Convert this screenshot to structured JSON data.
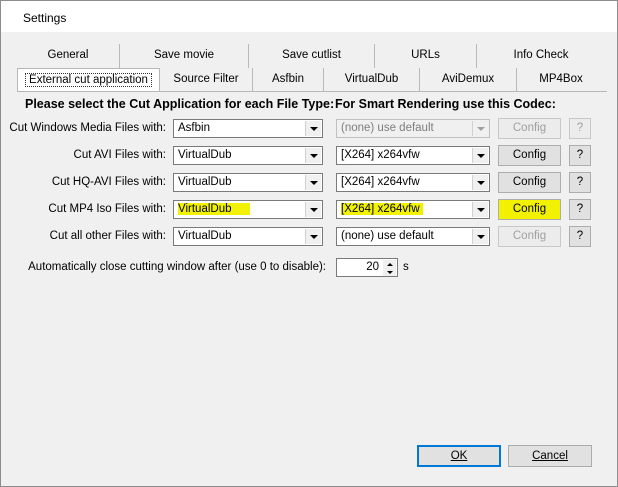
{
  "window": {
    "title": "Settings"
  },
  "tabs_row1": [
    "General",
    "Save movie",
    "Save cutlist",
    "URLs",
    "Info Check"
  ],
  "tabs_row2": [
    "External cut application",
    "Source Filter",
    "Asfbin",
    "VirtualDub",
    "AviDemux",
    "MP4Box"
  ],
  "active_tab": "External cut application",
  "headers": {
    "cut_app": "Please select the Cut Application for each File Type:",
    "codec": "For Smart Rendering use this Codec:"
  },
  "rows": [
    {
      "label": "Cut Windows Media Files with:",
      "app": "Asfbin",
      "codec": "(none) use default",
      "codec_enabled": false,
      "config": "Config",
      "help": "?",
      "highlighted": false
    },
    {
      "label": "Cut AVI Files with:",
      "app": "VirtualDub",
      "codec": "[X264] x264vfw",
      "codec_enabled": true,
      "config": "Config",
      "help": "?",
      "highlighted": false
    },
    {
      "label": "Cut HQ-AVI Files with:",
      "app": "VirtualDub",
      "codec": "[X264] x264vfw",
      "codec_enabled": true,
      "config": "Config",
      "help": "?",
      "highlighted": false
    },
    {
      "label": "Cut MP4 Iso Files with:",
      "app": "VirtualDub",
      "codec": "[X264] x264vfw",
      "codec_enabled": true,
      "config": "Config",
      "help": "?",
      "highlighted": true
    },
    {
      "label": "Cut all other Files with:",
      "app": "VirtualDub",
      "codec": "(none) use default",
      "codec_enabled": true,
      "config": "Config",
      "config_enabled": false,
      "help": "?",
      "highlighted": false
    }
  ],
  "autoclose": {
    "label": "Automatically close cutting window after (use 0 to disable):",
    "value": "20",
    "unit": "s"
  },
  "buttons": {
    "ok": "OK",
    "cancel": "Cancel"
  },
  "colors": {
    "highlight": "#f2f200",
    "focus_border": "#0078d7"
  }
}
